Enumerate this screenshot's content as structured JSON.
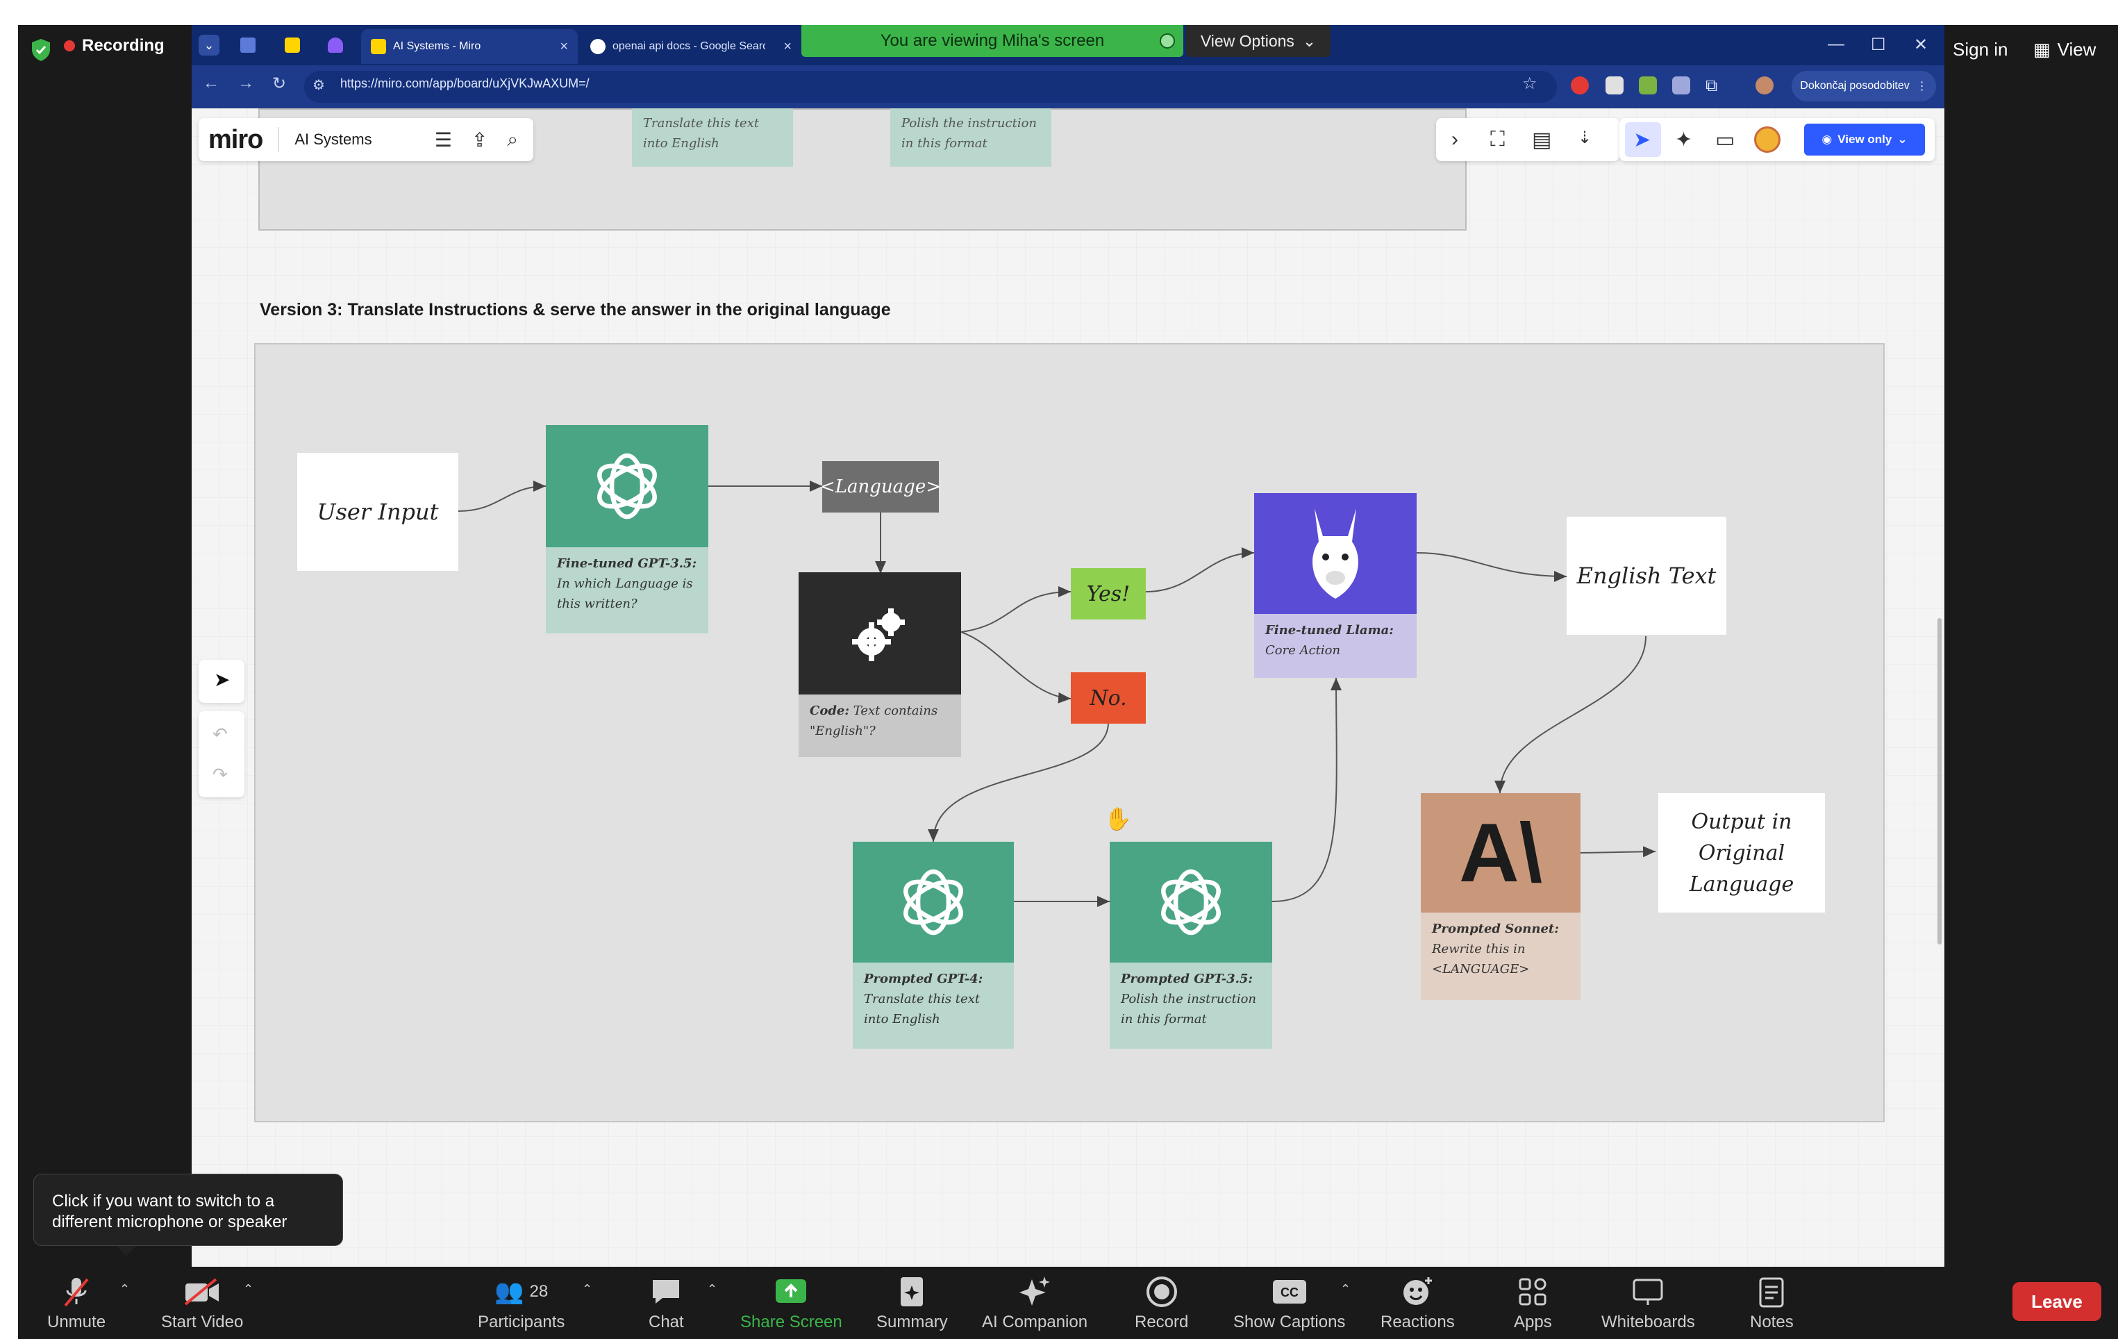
{
  "zoom": {
    "recording_label": "Recording",
    "sign_in": "Sign in",
    "view_label": "View",
    "screen_banner": "You are viewing Miha's screen",
    "view_options": "View Options",
    "toolbar": [
      {
        "label": "Unmute",
        "icon": "mic-muted-icon"
      },
      {
        "label": "Start Video",
        "icon": "video-off-icon"
      },
      {
        "label": "Participants",
        "icon": "participants-icon",
        "count": "28"
      },
      {
        "label": "Chat",
        "icon": "chat-icon"
      },
      {
        "label": "Share Screen",
        "icon": "share-screen-icon"
      },
      {
        "label": "Summary",
        "icon": "summary-icon"
      },
      {
        "label": "AI Companion",
        "icon": "sparkle-icon"
      },
      {
        "label": "Record",
        "icon": "record-icon"
      },
      {
        "label": "Show Captions",
        "icon": "cc-icon"
      },
      {
        "label": "Reactions",
        "icon": "reactions-icon"
      },
      {
        "label": "Apps",
        "icon": "apps-icon"
      },
      {
        "label": "Whiteboards",
        "icon": "whiteboard-icon"
      },
      {
        "label": "Notes",
        "icon": "notes-icon"
      }
    ],
    "leave": "Leave",
    "tooltip": "Click if you want to switch to a different microphone or speaker",
    "share_color": "#3bb54a",
    "leave_color": "#d32f2f"
  },
  "browser": {
    "tabs": [
      {
        "title": "AI Systems - Miro",
        "active": true
      },
      {
        "title": "openai api docs - Google Searc",
        "active": false
      }
    ],
    "url": "https://miro.com/app/board/uXjVKJwAXUM=/",
    "update_button": "Dokončaj posodobitev",
    "accent": "#1e3a8a"
  },
  "miro": {
    "logo": "miro",
    "board_name": "AI Systems",
    "view_only": "View only",
    "top_frame_notes": [
      "Translate this text into English",
      "Polish the instruction in this format"
    ],
    "section_title": "Version 3: Translate Instructions & serve the answer in the original language",
    "nodes": {
      "user_input": "User Input",
      "gpt35_title": "Fine-tuned GPT-3.5:",
      "gpt35_body": "In which Language is this written?",
      "language": "<Language>",
      "code_title": "Code:",
      "code_body": "Text contains \"English\"?",
      "yes": "Yes!",
      "no": "No.",
      "llama_title": "Fine-tuned Llama:",
      "llama_body": "Core Action",
      "english_text": "English Text",
      "gpt4_title": "Prompted GPT-4:",
      "gpt4_body": "Translate this text into English",
      "gpt35b_title": "Prompted GPT-3.5:",
      "gpt35b_body": "Polish the instruction in this format",
      "sonnet_title": "Prompted Sonnet:",
      "sonnet_body": "Rewrite this in <LANGUAGE>",
      "output": "Output in Original Language",
      "anthropic_logo": "A\\"
    },
    "colors": {
      "openai_green": "#4aa585",
      "openai_caption": "#b9d7cc",
      "llama_purple": "#5b4cd6",
      "llama_caption": "#c9c4e8",
      "code_dark": "#2b2b2b",
      "yes_green": "#8fd14f",
      "no_red": "#e8542f",
      "sonnet_tan": "#c9987a",
      "sonnet_caption": "#e3d0c4"
    }
  }
}
